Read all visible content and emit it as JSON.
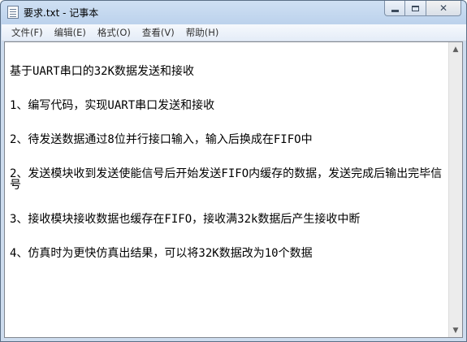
{
  "window": {
    "title": "要求.txt - 记事本"
  },
  "icons": {
    "app": "notepad-icon",
    "minimize": "minimize-icon",
    "maximize": "maximize-icon",
    "close": "close-icon",
    "scroll_up": "arrow-up-icon",
    "scroll_down": "arrow-down-icon"
  },
  "caption": {
    "close_glyph": "✕"
  },
  "menu": {
    "items": [
      {
        "label": "文件(F)"
      },
      {
        "label": "编辑(E)"
      },
      {
        "label": "格式(O)"
      },
      {
        "label": "查看(V)"
      },
      {
        "label": "帮助(H)"
      }
    ]
  },
  "document": {
    "lines": [
      "基于UART串口的32K数据发送和接收",
      "1、编写代码，实现UART串口发送和接收",
      "2、待发送数据通过8位并行接口输入，输入后换成在FIFO中",
      "2、发送模块收到发送使能信号后开始发送FIFO内缓存的数据，发送完成后输出完毕信号",
      "3、接收模块接收数据也缓存在FIFO，接收满32k数据后产生接收中断",
      "4、仿真时为更快仿真出结果，可以将32K数据改为10个数据"
    ]
  },
  "scrollbar": {
    "up_glyph": "▲",
    "down_glyph": "▼"
  }
}
